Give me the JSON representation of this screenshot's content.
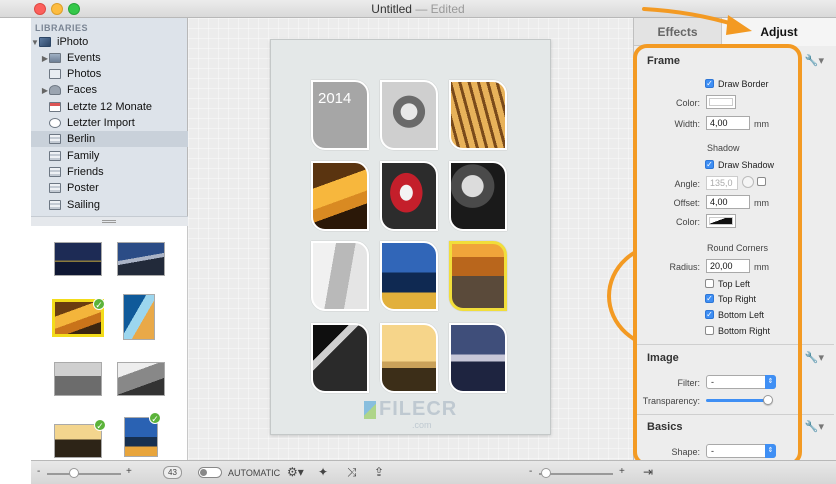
{
  "window": {
    "title": "Untitled",
    "edited": "Edited"
  },
  "sidebar": {
    "header": "LIBRARIES",
    "items": [
      {
        "label": "iPhoto",
        "icon": "iphoto-library-icon",
        "disclosure": "open"
      },
      {
        "label": "Events",
        "icon": "events-icon",
        "disclosure": "closed"
      },
      {
        "label": "Photos",
        "icon": "photos-icon",
        "disclosure": ""
      },
      {
        "label": "Faces",
        "icon": "faces-icon",
        "disclosure": "closed"
      },
      {
        "label": "Letzte 12 Monate",
        "icon": "calendar-icon",
        "disclosure": ""
      },
      {
        "label": "Letzter Import",
        "icon": "clock-icon",
        "disclosure": ""
      },
      {
        "label": "Berlin",
        "icon": "album-icon",
        "disclosure": "",
        "selected": true
      },
      {
        "label": "Family",
        "icon": "album-icon",
        "disclosure": ""
      },
      {
        "label": "Friends",
        "icon": "album-icon",
        "disclosure": ""
      },
      {
        "label": "Poster",
        "icon": "album-icon",
        "disclosure": ""
      },
      {
        "label": "Sailing",
        "icon": "album-icon",
        "disclosure": ""
      }
    ]
  },
  "canvas": {
    "year_label": "2014",
    "watermark": "FILECR",
    "watermark_sub": ".com"
  },
  "inspector": {
    "tabs": {
      "effects": "Effects",
      "adjust": "Adjust"
    },
    "frame": {
      "title": "Frame",
      "draw_border": "Draw Border",
      "color_label": "Color:",
      "width_label": "Width:",
      "width_value": "4,00",
      "width_unit": "mm",
      "shadow_header": "Shadow",
      "draw_shadow": "Draw Shadow",
      "angle_label": "Angle:",
      "angle_value": "135,0",
      "offset_label": "Offset:",
      "offset_value": "4,00",
      "offset_unit": "mm",
      "shadow_color_label": "Color:",
      "round_corners_header": "Round Corners",
      "radius_label": "Radius:",
      "radius_value": "20,00",
      "radius_unit": "mm",
      "top_left": "Top Left",
      "top_right": "Top Right",
      "bottom_left": "Bottom Left",
      "bottom_right": "Bottom Right"
    },
    "image": {
      "title": "Image",
      "filter_label": "Filter:",
      "filter_value": "-",
      "transparency_label": "Transparency:",
      "transparency_level": 0.97
    },
    "basics": {
      "title": "Basics",
      "shape_label": "Shape:",
      "shape_value": "-"
    }
  },
  "bottombar": {
    "photo_count": "43",
    "automatic_label": "AUTOMATIC",
    "minus": "-",
    "plus": "+"
  },
  "colors": {
    "annotation": "#f39a23",
    "selection_yellow": "#f3dc1a",
    "accent_blue": "#3f8ff4",
    "check_green": "#5bb33a"
  }
}
